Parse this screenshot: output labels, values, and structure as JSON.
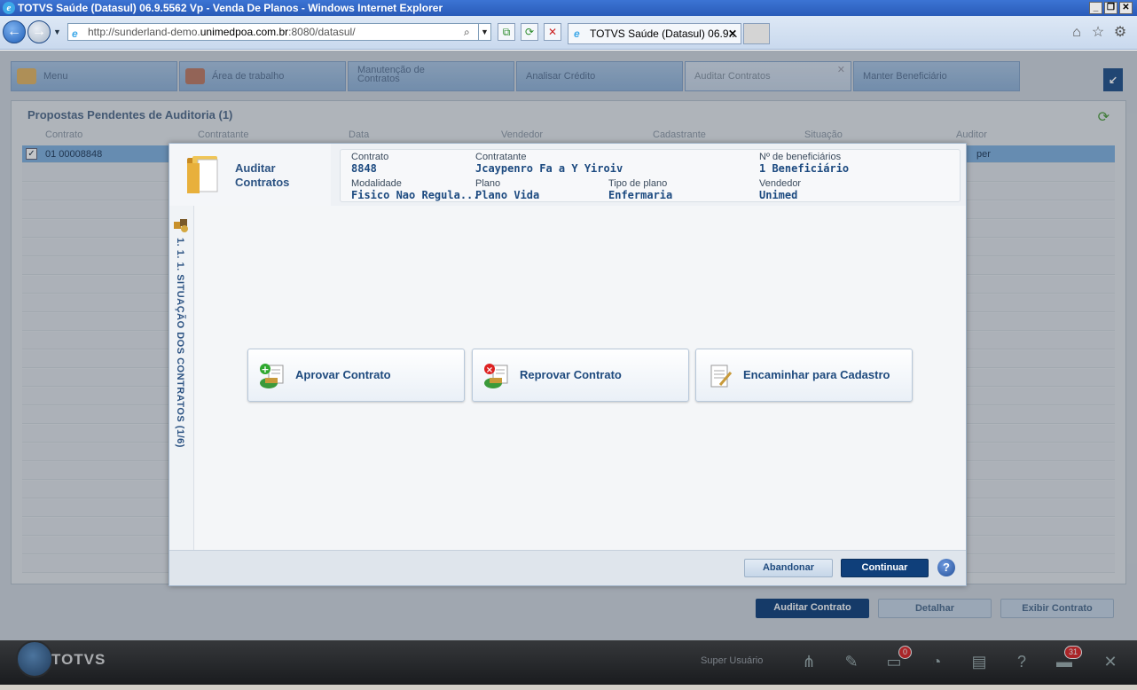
{
  "window": {
    "title": "TOTVS Saúde (Datasul) 06.9.5562 Vp - Venda De Planos - Windows Internet Explorer"
  },
  "browser": {
    "address_prefix": "http://sunderland-demo.",
    "address_highlight": "unimedpoa.com.br",
    "address_suffix": ":8080/datasul/",
    "tab_label": "TOTVS Saúde (Datasul) 06.9...",
    "tab_close": "✕"
  },
  "app_tabs": [
    {
      "label": "Menu"
    },
    {
      "label": "Área de trabalho"
    },
    {
      "label": "Manutenção de Contratos"
    },
    {
      "label": "Analisar Crédito"
    },
    {
      "label": "Auditar Contratos"
    },
    {
      "label": "Manter Beneficiário"
    }
  ],
  "grid": {
    "title": "Propostas Pendentes de Auditoria (1)",
    "columns": [
      "Contrato",
      "Contratante",
      "Data",
      "Vendedor",
      "Cadastrante",
      "Situação",
      "Auditor"
    ],
    "selected_row": {
      "contrato": "01 00008848",
      "auditor": "per"
    }
  },
  "bottom_buttons": {
    "auditar": "Auditar Contrato",
    "detalhar": "Detalhar",
    "exibir": "Exibir Contrato"
  },
  "taskbar": {
    "brand": "TOTVS",
    "user": "Super Usuário",
    "badge_notifications": "0",
    "badge_messages": "31"
  },
  "modal": {
    "title": "Auditar Contratos",
    "info": {
      "contrato_label": "Contrato",
      "contrato_value": "8848",
      "contratante_label": "Contratante",
      "contratante_value": "Jcaypenro Fa a  Y  Yiroiv",
      "beneficiarios_label": "Nº de beneficiários",
      "beneficiarios_value": "1 Beneficiário",
      "modalidade_label": "Modalidade",
      "modalidade_value": "Fisico Nao Regula...",
      "plano_label": "Plano",
      "plano_value": "Plano Vida",
      "tipo_label": "Tipo de plano",
      "tipo_value": "Enfermaria",
      "vendedor_label": "Vendedor",
      "vendedor_value": "Unimed"
    },
    "step_label": "1. 1. 1. SITUAÇÃO DOS CONTRATOS (1/6)",
    "actions": {
      "aprovar": "Aprovar Contrato",
      "reprovar": "Reprovar Contrato",
      "encaminhar": "Encaminhar para Cadastro"
    },
    "footer": {
      "abandonar": "Abandonar",
      "continuar": "Continuar",
      "help": "?"
    }
  },
  "colors": {
    "primary_blue": "#1e4a7e",
    "button_dark": "#0f3f7a",
    "title_bar": "#2a5bb8"
  }
}
